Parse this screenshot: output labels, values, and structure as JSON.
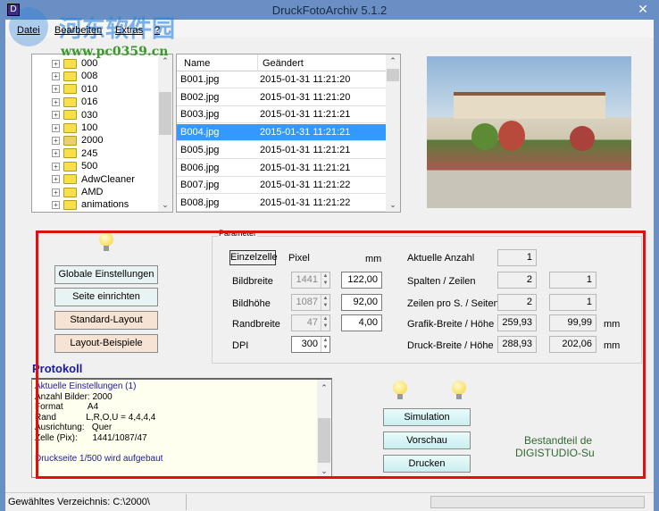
{
  "window": {
    "title": "DruckFotoArchiv  5.1.2",
    "close": "✕",
    "app_icon": "D"
  },
  "watermark": {
    "text": "河东软件园",
    "url": "www.pc0359.cn"
  },
  "menu": [
    "Datei",
    "Bearbeiten",
    "Extras",
    "?"
  ],
  "tree": {
    "items": [
      {
        "label": "000"
      },
      {
        "label": "008"
      },
      {
        "label": "010"
      },
      {
        "label": "016"
      },
      {
        "label": "030"
      },
      {
        "label": "100"
      },
      {
        "label": "2000",
        "open": true
      },
      {
        "label": "245"
      },
      {
        "label": "500"
      },
      {
        "label": "AdwCleaner"
      },
      {
        "label": "AMD"
      },
      {
        "label": "animations"
      }
    ]
  },
  "filelist": {
    "columns": [
      "Name",
      "Geändert"
    ],
    "rows": [
      {
        "name": "B001.jpg",
        "date": "2015-01-31 11:21:20"
      },
      {
        "name": "B002.jpg",
        "date": "2015-01-31 11:21:20"
      },
      {
        "name": "B003.jpg",
        "date": "2015-01-31 11:21:21"
      },
      {
        "name": "B004.jpg",
        "date": "2015-01-31 11:21:21",
        "selected": true
      },
      {
        "name": "B005.jpg",
        "date": "2015-01-31 11:21:21"
      },
      {
        "name": "B006.jpg",
        "date": "2015-01-31 11:21:21"
      },
      {
        "name": "B007.jpg",
        "date": "2015-01-31 11:21:22"
      },
      {
        "name": "B008.jpg",
        "date": "2015-01-31 11:21:22"
      }
    ]
  },
  "left_buttons": {
    "global": "Globale Einstellungen",
    "page": "Seite einrichten",
    "standard": "Standard-Layout",
    "examples": "Layout-Beispiele"
  },
  "parameter": {
    "group_label": "Parameter",
    "cell_button": "Einzelzelle",
    "pixel_header": "Pixel",
    "mm_header": "mm",
    "bildbreite": {
      "label": "Bildbreite",
      "pixel": "1441",
      "mm": "122,00"
    },
    "bildhoehe": {
      "label": "Bildhöhe",
      "pixel": "1087",
      "mm": "92,00"
    },
    "randbreite": {
      "label": "Randbreite",
      "pixel": "47",
      "mm": "4,00"
    },
    "dpi": {
      "label": "DPI",
      "value": "300"
    },
    "aktuelle_anzahl": {
      "label": "Aktuelle Anzahl",
      "v1": "1"
    },
    "spalten_zeilen": {
      "label": "Spalten / Zeilen",
      "v1": "2",
      "v2": "1"
    },
    "zeilen_seiten": {
      "label": "Zeilen pro S. / Seiten",
      "v1": "2",
      "v2": "1"
    },
    "grafik": {
      "label": "Grafik-Breite / Höhe",
      "v1": "259,93",
      "v2": "99,99",
      "unit": "mm"
    },
    "druck": {
      "label": "Druck-Breite / Höhe",
      "v1": "288,93",
      "v2": "202,06",
      "unit": "mm"
    }
  },
  "protokoll": {
    "title": "Protokoll",
    "lines": [
      "Aktuelle Einstellungen (1)",
      "Anzahl Bilder: 2000",
      "Format          A4",
      "Rand            L,R,O,U = 4,4,4,4",
      "Ausrichtung:   Quer",
      "Zelle (Pix):      1441/1087/47",
      "",
      "Druckseite 1/500 wird aufgebaut"
    ]
  },
  "actions": {
    "simulation": "Simulation",
    "preview": "Vorschau",
    "print": "Drucken"
  },
  "brand": {
    "line1": "Bestandteil de",
    "line2": "DIGISTUDIO-Su"
  },
  "status": {
    "directory": "Gewähltes Verzeichnis: C:\\2000\\"
  }
}
